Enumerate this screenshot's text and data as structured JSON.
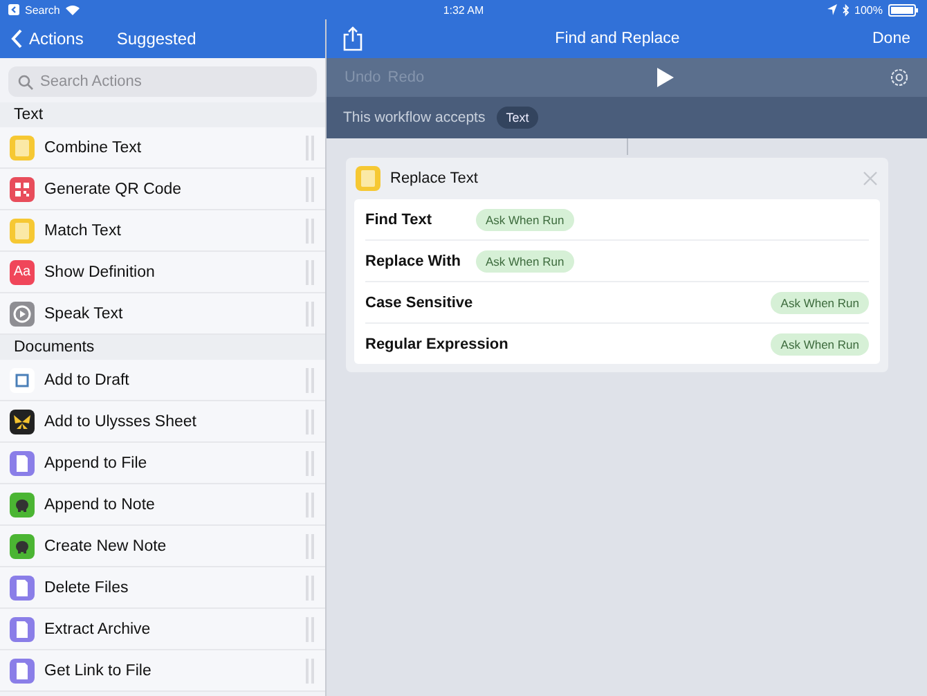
{
  "status_bar": {
    "back_app": "Search",
    "time": "1:32 AM",
    "battery": "100%"
  },
  "sidebar": {
    "back": "Actions",
    "title": "Suggested",
    "search": {
      "placeholder": "Search Actions"
    },
    "sections": [
      {
        "title": "Text",
        "items": [
          {
            "label": "Combine Text",
            "kind": "note"
          },
          {
            "label": "Generate QR Code",
            "kind": "qr"
          },
          {
            "label": "Match Text",
            "kind": "note"
          },
          {
            "label": "Show Definition",
            "kind": "dictionary",
            "icon_text": "Aa"
          },
          {
            "label": "Speak Text",
            "kind": "gear"
          }
        ]
      },
      {
        "title": "Documents",
        "items": [
          {
            "label": "Add to Draft",
            "kind": "draft"
          },
          {
            "label": "Add to Ulysses Sheet",
            "kind": "butterfly"
          },
          {
            "label": "Append to File",
            "kind": "file"
          },
          {
            "label": "Append to Note",
            "kind": "elephant"
          },
          {
            "label": "Create New Note",
            "kind": "elephant"
          },
          {
            "label": "Delete Files",
            "kind": "file"
          },
          {
            "label": "Extract Archive",
            "kind": "file"
          },
          {
            "label": "Get Link to File",
            "kind": "file"
          }
        ]
      }
    ]
  },
  "editor": {
    "title": "Find and Replace",
    "done": "Done",
    "undo": "Undo",
    "redo": "Redo",
    "accepts_label": "This workflow accepts",
    "accepts_type": "Text",
    "action": {
      "title": "Replace Text",
      "params": [
        {
          "label": "Find Text",
          "value": "Ask When Run",
          "kind": "inline"
        },
        {
          "label": "Replace With",
          "value": "Ask When Run",
          "kind": "inline"
        },
        {
          "label": "Case Sensitive",
          "value": "Ask When Run",
          "kind": "right"
        },
        {
          "label": "Regular Expression",
          "value": "Ask When Run",
          "kind": "right"
        }
      ]
    }
  }
}
